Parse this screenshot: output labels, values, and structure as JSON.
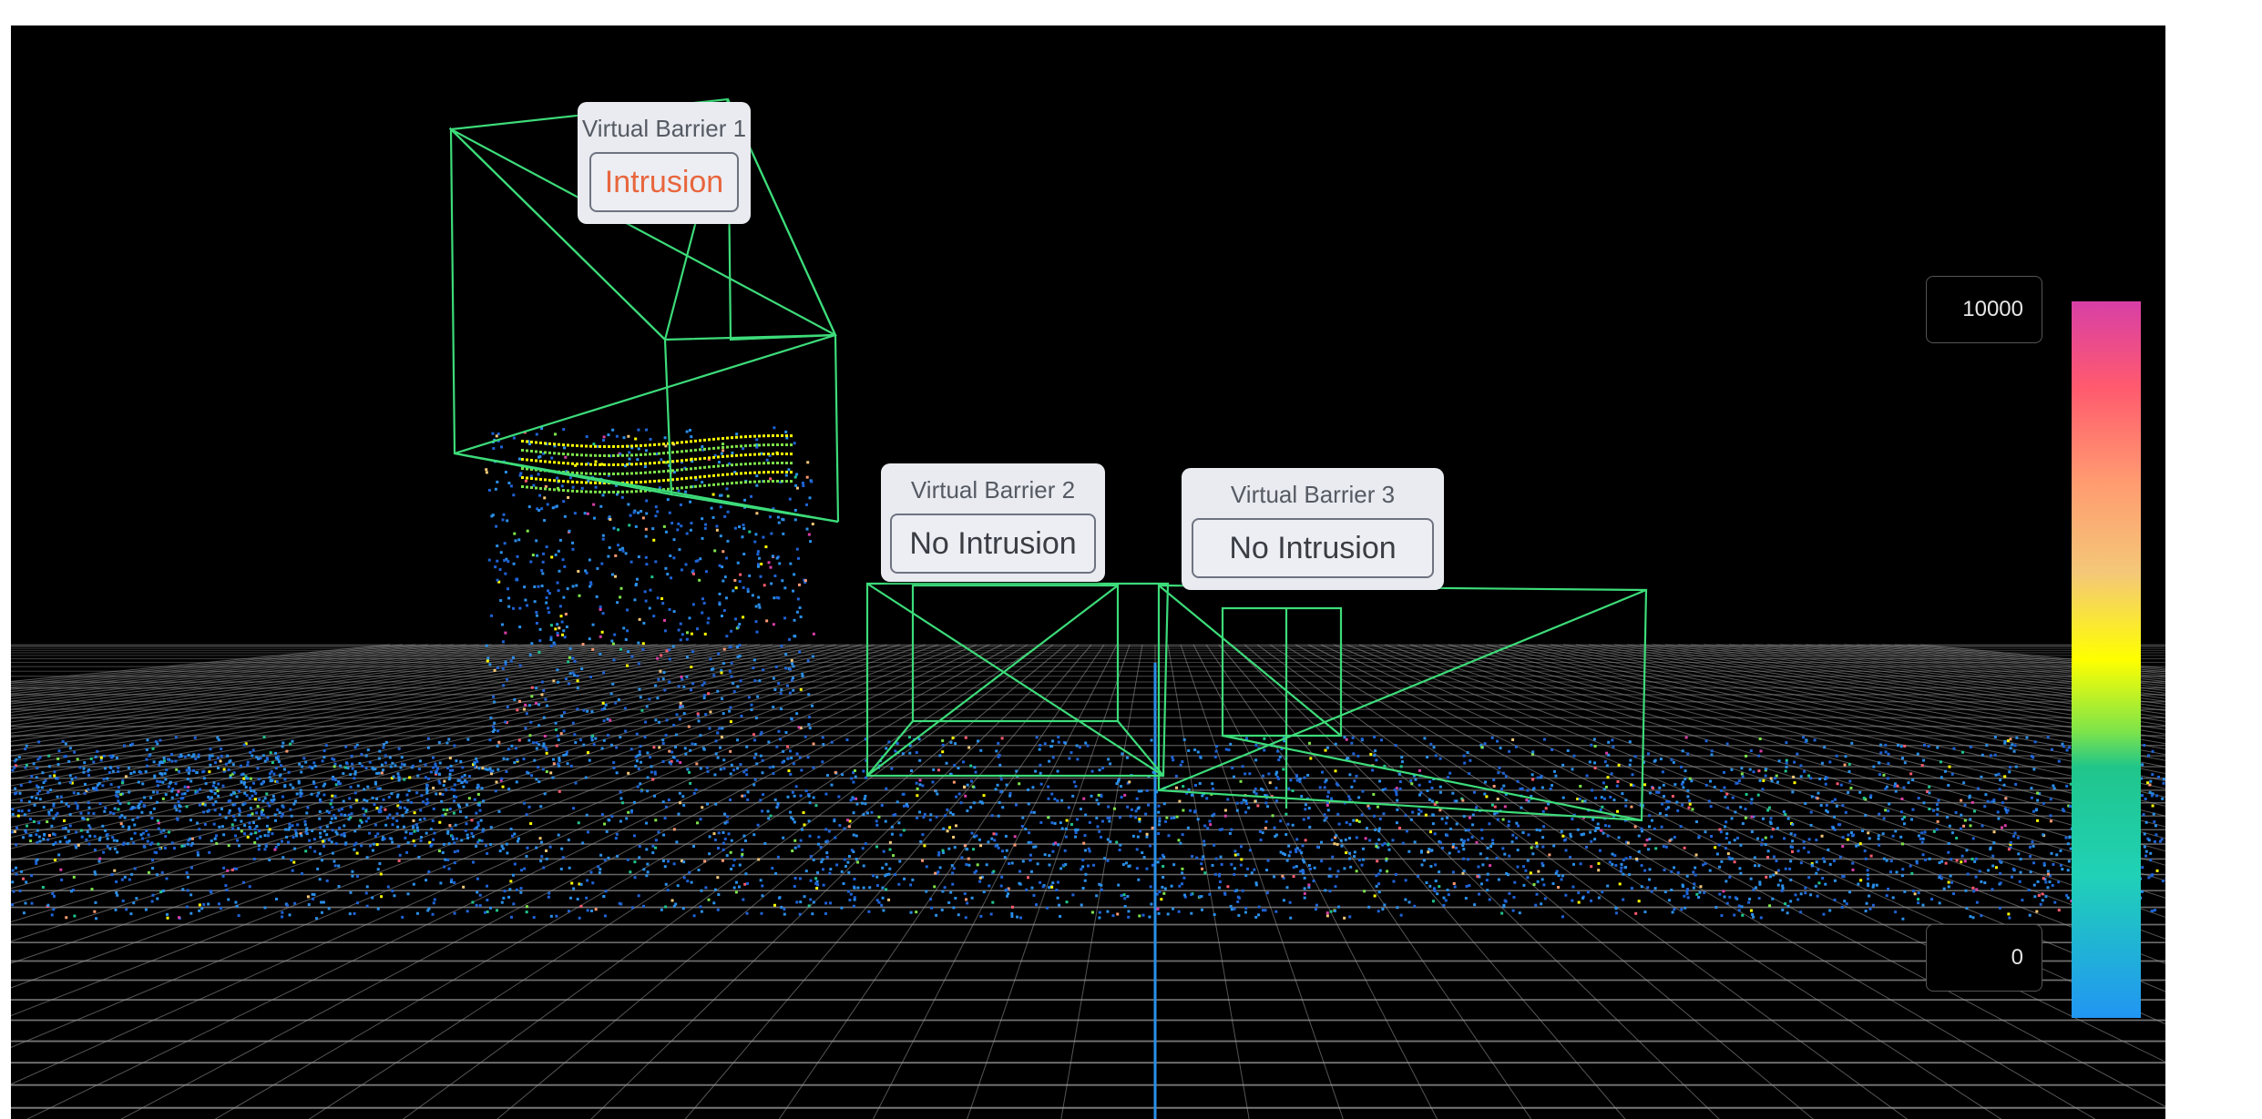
{
  "viewer": {
    "barriers": [
      {
        "title": "Virtual Barrier 1",
        "status": "Intrusion",
        "status_color": "#e8663d"
      },
      {
        "title": "Virtual Barrier 2",
        "status": "No Intrusion",
        "status_color": "#3a3d44"
      },
      {
        "title": "Virtual Barrier 3",
        "status": "No Intrusion",
        "status_color": "#3a3d44"
      }
    ],
    "color_scale": {
      "max_label": "10000",
      "min_label": "0",
      "gradient_colors": [
        "#d83fa6",
        "#ff5a6e",
        "#ff9a70",
        "#f4c878",
        "#ffff00",
        "#7ee44a",
        "#20c58a",
        "#20d1b6",
        "#2196f3"
      ]
    },
    "colors": {
      "background": "#000000",
      "grid": "#9a9a9a",
      "barrier_wireframe": "#3ddc7a",
      "vertical_axis": "#2a8fe8"
    }
  }
}
